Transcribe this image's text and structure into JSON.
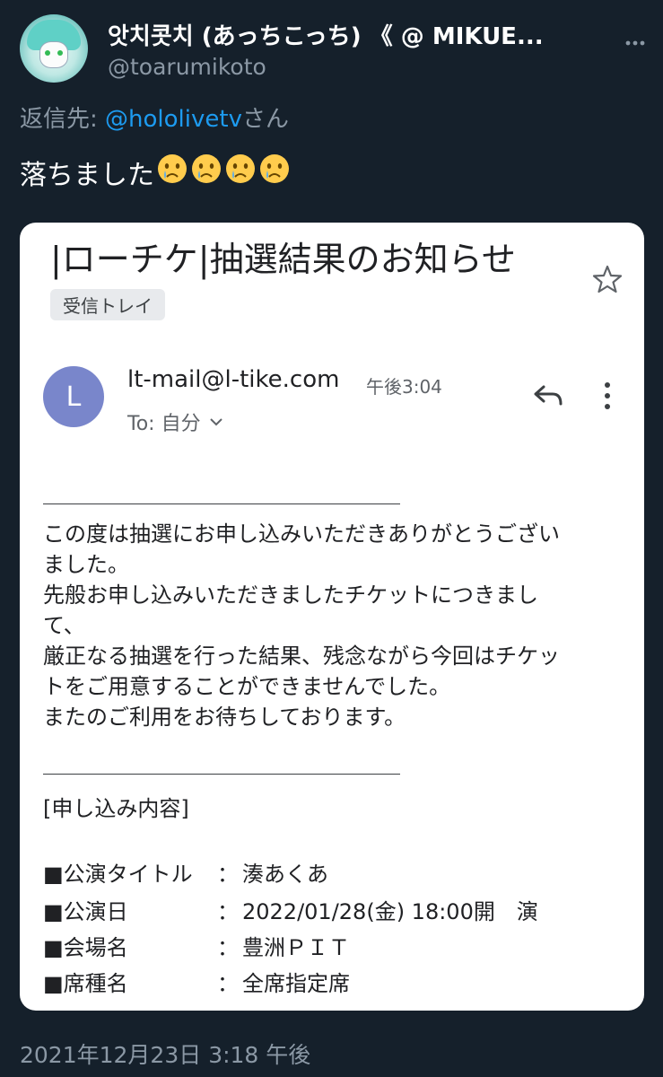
{
  "tweet": {
    "display_name": "앗치콧치 (あっちこっち) 《 @ MIKUE...",
    "handle": "@toarumikoto",
    "reply_prefix": "返信先: ",
    "reply_mention": "@hololivetv",
    "reply_suffix": "さん",
    "text": "落ちました",
    "emojis": [
      "crying-face",
      "crying-face",
      "crying-face",
      "crying-face"
    ],
    "timestamp": "2021年12月23日 3:18 午後"
  },
  "email": {
    "subject": "|ローチケ|抽選結果のお知らせ",
    "label": "受信トレイ",
    "sender_initial": "L",
    "sender_email": "lt-mail@l-tike.com",
    "time": "午後3:04",
    "to": "To: 自分",
    "body_lines": [
      "この度は抽選にお申し込みいただきありがとうござい",
      "ました。",
      "先般お申し込みいただきましたチケットにつきまし",
      "て、",
      "厳正なる抽選を行った結果、残念ながら今回はチケッ",
      "トをご用意することができませんでした。",
      "またのご利用をお待ちしております。"
    ],
    "section_title": "[申し込み内容]",
    "details": [
      {
        "key": "■公演タイトル",
        "sep": "：",
        "value": "湊あくあ"
      },
      {
        "key": "■公演日",
        "sep": "：",
        "value": "2022/01/28(金) 18:00開　演"
      },
      {
        "key": "■会場名",
        "sep": "：",
        "value": "豊洲ＰＩＴ"
      },
      {
        "key": "■席種名",
        "sep": "：",
        "value": "全席指定席"
      }
    ]
  },
  "colors": {
    "background": "#15202b",
    "mention": "#1d9bf0",
    "muted": "#8b98a5",
    "sender_avatar": "#7986cb"
  }
}
